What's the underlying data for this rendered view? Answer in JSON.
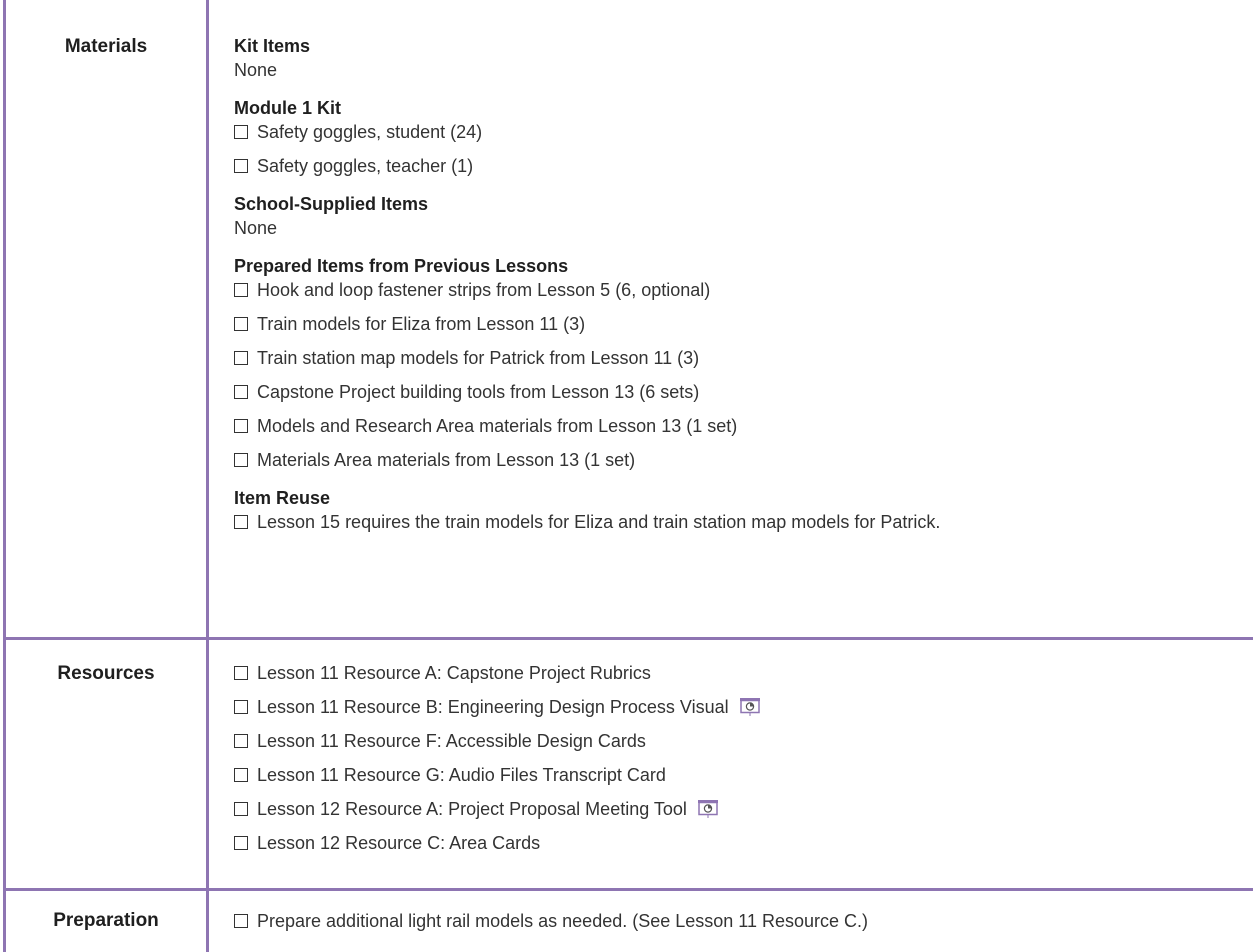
{
  "rows": {
    "materials": {
      "heading": "Materials",
      "kit_items": {
        "title": "Kit Items",
        "text": "None"
      },
      "module_kit": {
        "title": "Module 1 Kit",
        "items": [
          "Safety goggles, student (24)",
          "Safety goggles, teacher (1)"
        ]
      },
      "school_supplied": {
        "title": "School-Supplied Items",
        "text": "None"
      },
      "prepared": {
        "title": "Prepared Items from Previous Lessons",
        "items": [
          "Hook and loop fastener strips from Lesson 5 (6, optional)",
          "Train models for Eliza from Lesson 11 (3)",
          "Train station map models for Patrick from Lesson 11 (3)",
          "Capstone Project building tools from Lesson 13 (6 sets)",
          "Models and Research Area materials from Lesson 13 (1 set)",
          "Materials Area materials from Lesson 13 (1 set)"
        ]
      },
      "reuse": {
        "title": "Item Reuse",
        "items": [
          "Lesson 15 requires the train models for Eliza and train station map models for Patrick."
        ]
      }
    },
    "resources": {
      "heading": "Resources",
      "items": [
        "Lesson 11 Resource A: Capstone Project Rubrics",
        "Lesson 11 Resource B: Engineering Design Process Visual",
        "Lesson 11 Resource F: Accessible Design Cards",
        "Lesson 11 Resource G: Audio Files Transcript Card",
        "Lesson 12 Resource A: Project Proposal Meeting Tool",
        "Lesson 12 Resource C: Area Cards"
      ],
      "slide_icon": "presentation-icon"
    },
    "preparation": {
      "heading": "Preparation",
      "items": [
        "Prepare additional light rail models as needed. (See Lesson 11 Resource C.)"
      ]
    }
  },
  "colors": {
    "border": "#8e75b2",
    "icon": "#8e75b2"
  }
}
